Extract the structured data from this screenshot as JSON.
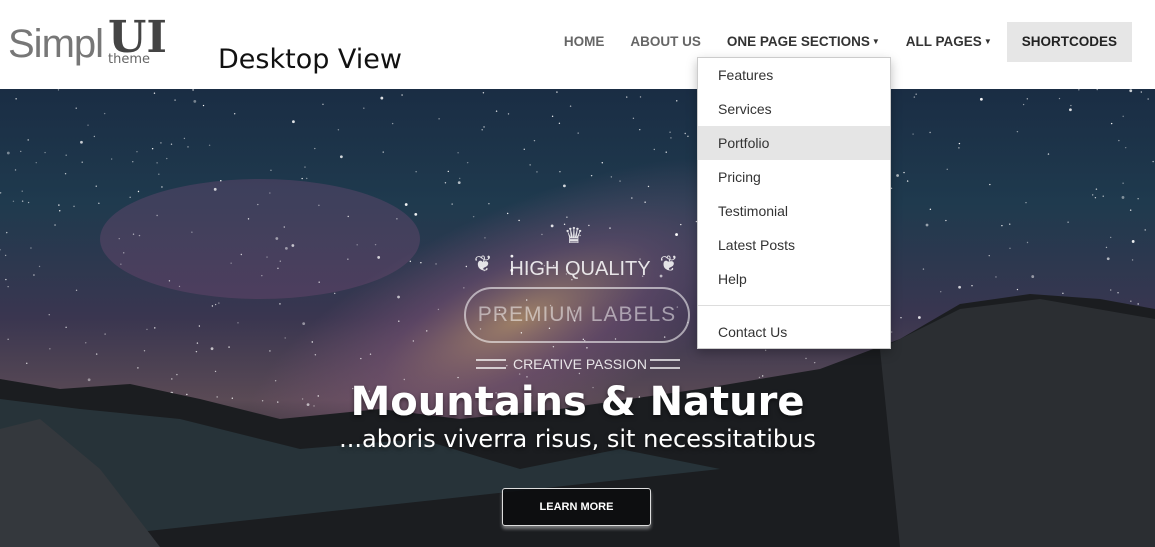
{
  "header": {
    "logo": {
      "part1": "Simpl",
      "part2": "UI",
      "part3": "theme"
    },
    "view_label": "Desktop View",
    "nav": [
      {
        "label": "HOME"
      },
      {
        "label": "ABOUT US"
      },
      {
        "label": "ONE PAGE SECTIONS",
        "caret": "▼"
      },
      {
        "label": "ALL PAGES",
        "caret": "▼"
      },
      {
        "label": "SHORTCODES"
      }
    ]
  },
  "dropdown": {
    "items": [
      "Features",
      "Services",
      "Portfolio",
      "Pricing",
      "Testimonial",
      "Latest Posts",
      "Help"
    ],
    "active": "Portfolio",
    "footer_item": "Contact Us"
  },
  "hero": {
    "badge": {
      "top": "HIGH QUALITY",
      "middle": "PREMIUM LABELS",
      "bottom": "CREATIVE PASSION",
      "icon": "crown-icon"
    },
    "title": "Mountains & Nature",
    "subtitle": "...aboris viverra risus, sit necessitatibus",
    "button": "LEARN MORE"
  }
}
